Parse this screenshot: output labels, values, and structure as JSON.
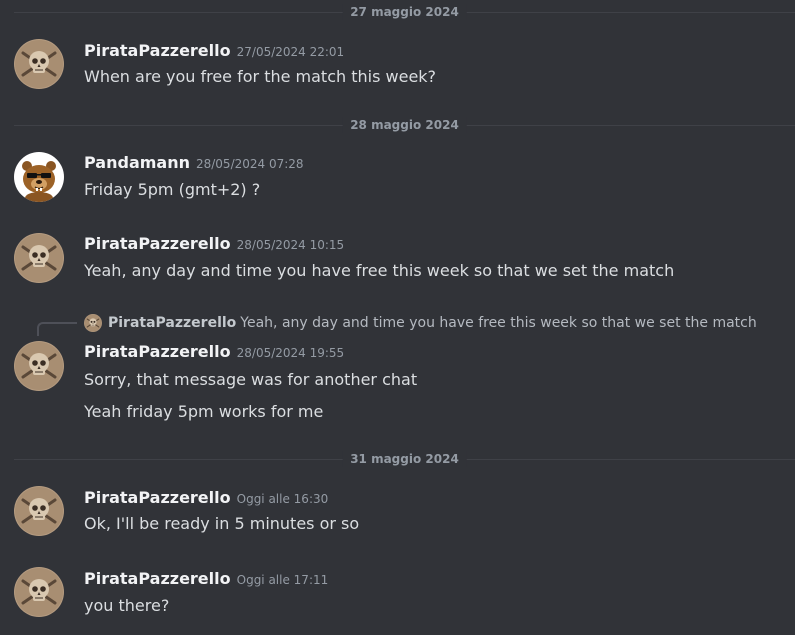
{
  "dividers": [
    {
      "label": "27 maggio 2024"
    },
    {
      "label": "28 maggio 2024"
    },
    {
      "label": "31 maggio 2024"
    }
  ],
  "messages": [
    {
      "user": "PirataPazzerello",
      "time": "27/05/2024 22:01",
      "lines": [
        "When are you free for the match this week?"
      ]
    },
    {
      "user": "Pandamann",
      "time": "28/05/2024 07:28",
      "lines": [
        "Friday 5pm (gmt+2) ?"
      ]
    },
    {
      "user": "PirataPazzerello",
      "time": "28/05/2024 10:15",
      "lines": [
        "Yeah, any day and time you have free this week so that we set the match"
      ]
    },
    {
      "user": "PirataPazzerello",
      "time": "28/05/2024 19:55",
      "lines": [
        "Sorry, that message was for another chat",
        "Yeah friday 5pm works for me"
      ]
    },
    {
      "user": "PirataPazzerello",
      "time": "Oggi alle 16:30",
      "lines": [
        "Ok, I'll be ready in 5 minutes or so"
      ]
    },
    {
      "user": "PirataPazzerello",
      "time": "Oggi alle 17:11",
      "lines": [
        "you there?"
      ]
    }
  ],
  "reply": {
    "user": "PirataPazzerello",
    "text": "Yeah, any day and time you have free this week so that we set the match"
  },
  "colors": {
    "background": "#313338",
    "username": "#f2f3f5",
    "timestamp": "#949ba4",
    "message": "#dbdee1"
  }
}
